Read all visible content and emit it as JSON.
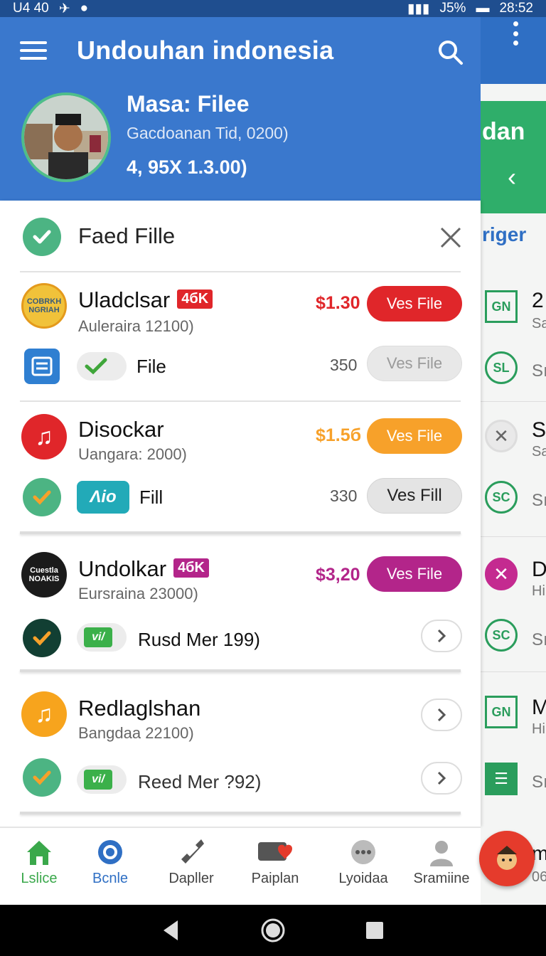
{
  "status_bar": {
    "time_left": "U4 40",
    "battery": "J5%",
    "clock": "28:52"
  },
  "app": {
    "title": "Undouhan indonesia"
  },
  "profile": {
    "name": "Masa: Filee",
    "subtitle": "Gacdoanan Tid, 0200)",
    "amount": "4, 95X 1.3.00)"
  },
  "favorite": {
    "label": "Faed Fille"
  },
  "items": [
    {
      "name": "Uladclsar",
      "tag": "4бK",
      "sub": "Auleraira 12100)",
      "price": "$1.30",
      "button": "Ves File",
      "logo": "COBRKH NGRIAH",
      "toggle_label": "File",
      "count": "350",
      "secondary_button": "Ves File"
    },
    {
      "name": "Disockar",
      "sub": "Uangara: 2000)",
      "price": "$1.5б",
      "button": "Ves File",
      "toggle_label": "Fill",
      "count": "330",
      "secondary_button": "Ves Fill",
      "chip": "Ʌio"
    },
    {
      "name": "Undolkar",
      "tag": "4бK",
      "sub": "Eursraina 23000)",
      "price": "$3,20",
      "button": "Ves File",
      "logo": "Cuestla NOAKIS",
      "toggle_label": "Rusd Mer 199)"
    },
    {
      "name": "Redlaglshan",
      "sub": "Bangdaa 22100)",
      "toggle_label": "Reed Mer ?92)"
    }
  ],
  "side_panel": {
    "header": "dan",
    "link": "riger",
    "rows": [
      {
        "badge": "GN",
        "title": "2",
        "sub": "Sa"
      },
      {
        "badge": "SL",
        "title": "",
        "sub": "Sı"
      },
      {
        "badge": "✕",
        "title": "S",
        "sub": "Sa"
      },
      {
        "badge": "SC",
        "title": "",
        "sub": "Sı"
      },
      {
        "badge": "✕",
        "title": "D",
        "sub": "Hi"
      },
      {
        "badge": "SC",
        "title": "",
        "sub": "Sı"
      },
      {
        "badge": "GN",
        "title": "M",
        "sub": "Hi"
      },
      {
        "badge": "",
        "title": "",
        "sub": "Sı"
      },
      {
        "badge": "",
        "title": "m",
        "sub": "06"
      }
    ]
  },
  "bottom_nav": [
    {
      "label": "Lslice",
      "color": "#3aa84b"
    },
    {
      "label": "Bcnle",
      "color": "#2f6fc4"
    },
    {
      "label": "Dapller",
      "color": "#444444"
    },
    {
      "label": "Paiplan",
      "color": "#444444"
    },
    {
      "label": "Lyoidaa",
      "color": "#444444"
    },
    {
      "label": "Sramiine",
      "color": "#444444"
    }
  ],
  "colors": {
    "header": "#3a78cd",
    "red": "#e0262a",
    "orange": "#f7a12a",
    "purple": "#b3258a",
    "green": "#4cb483"
  }
}
